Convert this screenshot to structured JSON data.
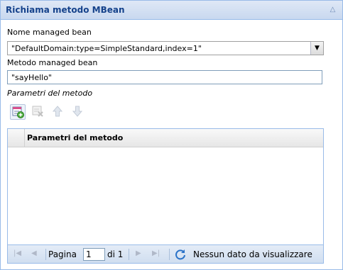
{
  "panel": {
    "title": "Richiama metodo MBean",
    "collapse_icon": "chevron-up-icon"
  },
  "form": {
    "bean_label": "Nome managed bean",
    "bean_value": "\"DefaultDomain:type=SimpleStandard,index=1\"",
    "method_label": "Metodo managed bean",
    "method_value": "\"sayHello\"",
    "params_label": "Parametri del metodo"
  },
  "toolbar": {
    "buttons": [
      {
        "icon": "add-param-icon",
        "enabled": true
      },
      {
        "icon": "delete-param-icon",
        "enabled": false
      },
      {
        "icon": "move-up-icon",
        "enabled": false
      },
      {
        "icon": "move-down-icon",
        "enabled": false
      }
    ]
  },
  "grid": {
    "column_header": "Parametri del metodo",
    "rows": []
  },
  "pager": {
    "page_label": "Pagina",
    "page_value": "1",
    "of_label": "di 1",
    "empty_message": "Nessun dato da visualizzare"
  },
  "colors": {
    "panel_border": "#99bbe8",
    "title_text": "#15428b",
    "header_bg": "#dfe8f6"
  }
}
